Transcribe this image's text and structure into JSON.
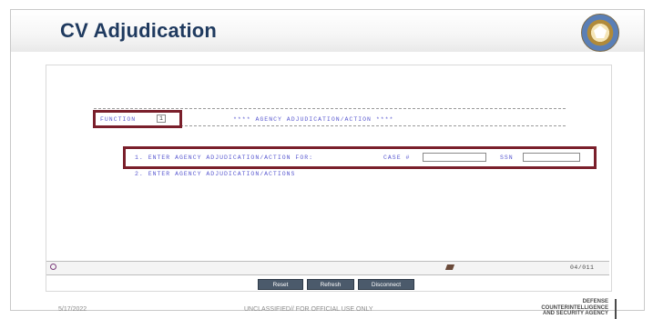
{
  "slide": {
    "title": "CV Adjudication",
    "date": "5/17/2022",
    "classification": "UNCLASSIFIED// FOR OFFICIAL USE ONLY",
    "agency_lines": [
      "DEFENSE",
      "COUNTERINTELLIGENCE",
      "AND SECURITY AGENCY"
    ]
  },
  "terminal": {
    "function_label": "FUNCTION",
    "function_value": "1",
    "screen_title": "**** AGENCY ADJUDICATION/ACTION ****",
    "option1": "1. ENTER AGENCY ADJUDICATION/ACTION FOR:",
    "case_label": "CASE #",
    "case_value": "",
    "ssn_label": "SSN",
    "ssn_value": "",
    "option2": "2. ENTER AGENCY ADJUDICATION/ACTIONS"
  },
  "status_bar": {
    "position": "04/011"
  },
  "buttons": {
    "reset": "Reset",
    "refresh": "Refresh",
    "disconnect": "Disconnect"
  },
  "colors": {
    "title": "#1f3a5f",
    "terminal_text": "#5a5ad0",
    "highlight_box": "#7a1f2b",
    "button": "#4b5a6b"
  }
}
